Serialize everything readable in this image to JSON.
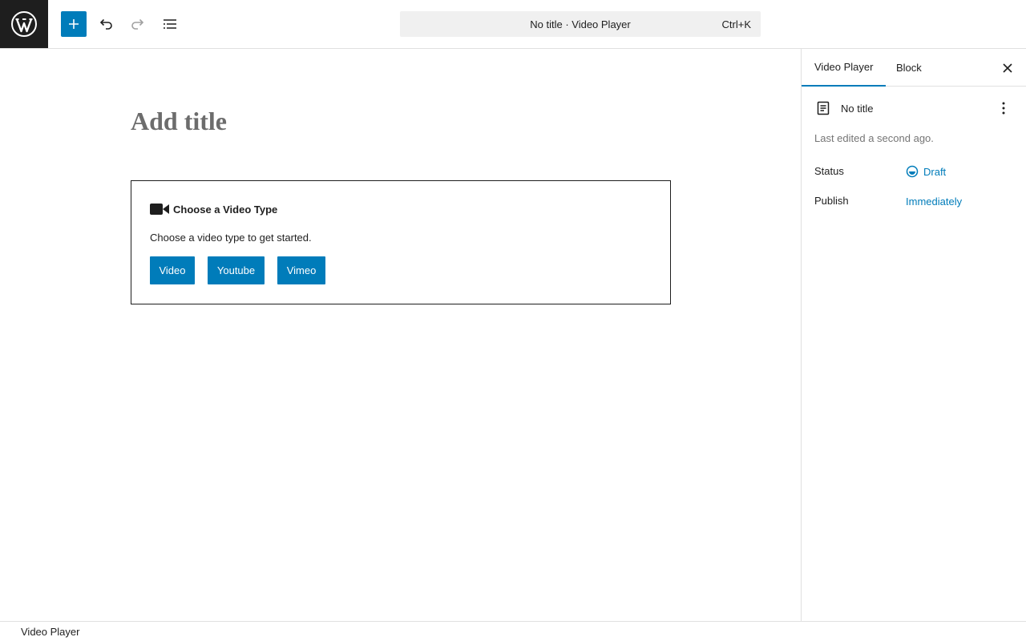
{
  "topbar": {
    "logo_icon": "wordpress-icon",
    "add_icon": "plus-icon",
    "undo_icon": "undo-icon",
    "redo_icon": "redo-icon",
    "list_icon": "document-overview-icon",
    "command_bar": {
      "title": "No title · Video Player",
      "shortcut": "Ctrl+K"
    }
  },
  "editor": {
    "title_placeholder": "Add title",
    "block": {
      "icon": "video-camera-icon",
      "heading": "Choose a Video Type",
      "description": "Choose a video type to get started.",
      "buttons": [
        "Video",
        "Youtube",
        "Vimeo"
      ]
    }
  },
  "sidebar": {
    "tabs": [
      "Video Player",
      "Block"
    ],
    "active_tab": "Video Player",
    "doc_title": "No title",
    "last_edited": "Last edited a second ago.",
    "rows": [
      {
        "label": "Status",
        "value": "Draft"
      },
      {
        "label": "Publish",
        "value": "Immediately"
      }
    ]
  },
  "footer": {
    "breadcrumb": "Video Player"
  },
  "colors": {
    "accent": "#007cba",
    "dark": "#1e1e1e",
    "border": "#e0e0e0"
  }
}
